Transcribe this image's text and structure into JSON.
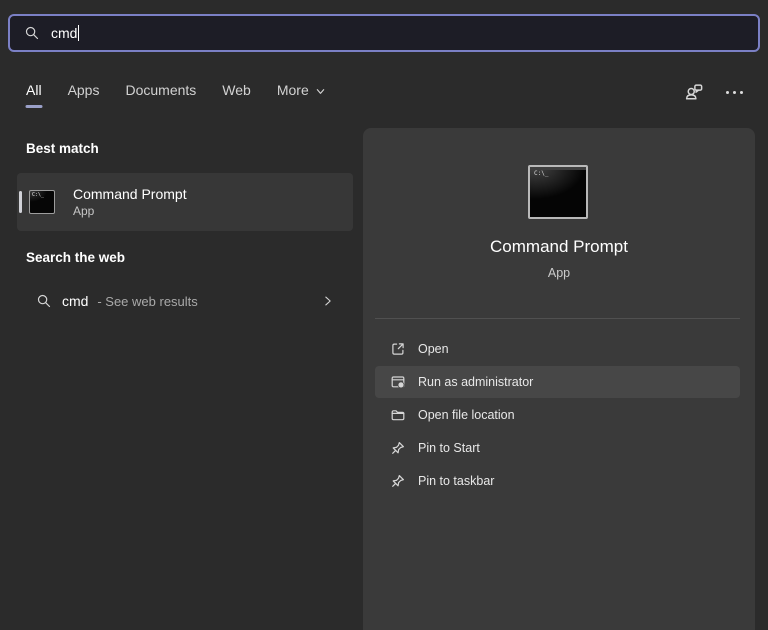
{
  "colors": {
    "search_border": "#7b80c5",
    "tab_underline": "#9aa0c8",
    "page_bg": "#2b2b2b",
    "panel_bg": "#3a3a3a",
    "row_highlight": "#474747",
    "best_match_bg": "#373737"
  },
  "search_box": {
    "value": "cmd",
    "icon": "search-icon"
  },
  "tabs": {
    "items": [
      {
        "label": "All",
        "active": true
      },
      {
        "label": "Apps",
        "active": false
      },
      {
        "label": "Documents",
        "active": false
      },
      {
        "label": "Web",
        "active": false
      },
      {
        "label": "More",
        "active": false,
        "has_chevron": true
      }
    ]
  },
  "header_icons": [
    {
      "name": "account-chat-icon"
    },
    {
      "name": "more-options-ellipsis-icon"
    }
  ],
  "sections": {
    "best_match": {
      "header": "Best match",
      "result": {
        "title": "Command Prompt",
        "subtitle": "App",
        "icon": "command-prompt-icon",
        "icon_glyph": "C:\\_",
        "selected": true
      }
    },
    "web": {
      "header": "Search the web",
      "result": {
        "query": "cmd",
        "suffix": "- See web results",
        "icon": "search-icon",
        "chevron": "chevron-right-icon"
      }
    }
  },
  "preview_panel": {
    "app": {
      "title": "Command Prompt",
      "subtitle": "App",
      "icon": "command-prompt-icon",
      "icon_glyph": "C:\\_"
    },
    "actions": [
      {
        "label": "Open",
        "icon": "open-external-icon",
        "highlighted": false
      },
      {
        "label": "Run as administrator",
        "icon": "run-as-admin-icon",
        "highlighted": true
      },
      {
        "label": "Open file location",
        "icon": "folder-icon",
        "highlighted": false
      },
      {
        "label": "Pin to Start",
        "icon": "pin-icon",
        "highlighted": false
      },
      {
        "label": "Pin to taskbar",
        "icon": "pin-icon",
        "highlighted": false
      }
    ]
  }
}
